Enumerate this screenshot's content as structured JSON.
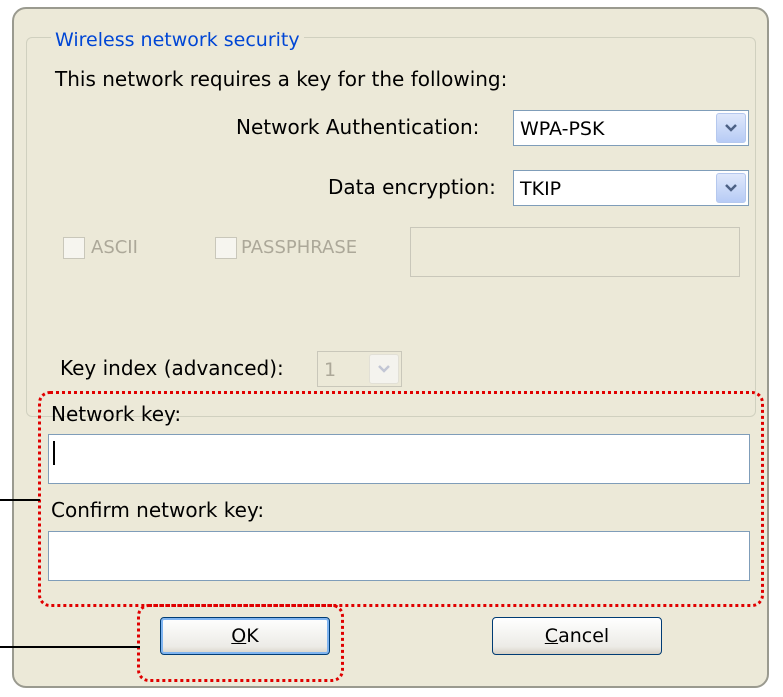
{
  "group": {
    "title": "Wireless network security"
  },
  "description": "This network requires a key for the following:",
  "auth": {
    "label": "Network Authentication:",
    "value": "WPA-PSK"
  },
  "encryption": {
    "label": "Data encryption:",
    "value": "TKIP"
  },
  "ascii": {
    "label": "ASCII",
    "checked": false
  },
  "passphrase": {
    "label": "PASSPHRASE",
    "checked": false
  },
  "key_index": {
    "label": "Key index (advanced):",
    "value": "1"
  },
  "network_key": {
    "label": "Network key:",
    "value": ""
  },
  "confirm_key": {
    "label": "Confirm network key:",
    "value": ""
  },
  "buttons": {
    "ok_rest": "K",
    "ok_mnemonic": "O",
    "cancel_rest": "ancel",
    "cancel_mnemonic": "C"
  },
  "colors": {
    "accent": "#0046d5",
    "highlight": "#e00000",
    "dialog_bg": "#ece9d8"
  }
}
